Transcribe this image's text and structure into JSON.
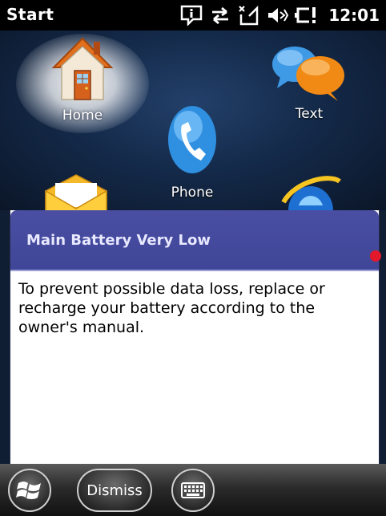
{
  "status_bar": {
    "title": "Start",
    "time": "12:01",
    "icons": [
      "notification-icon",
      "sync-icon",
      "no-signal-icon",
      "volume-muted-icon",
      "battery-low-icon"
    ]
  },
  "home": {
    "tiles": [
      {
        "label": "Home",
        "icon": "house-icon"
      },
      {
        "label": "Phone",
        "icon": "phone-icon"
      },
      {
        "label": "Text",
        "icon": "speech-bubbles-icon"
      },
      {
        "label": "",
        "icon": "mail-icon"
      },
      {
        "label": "",
        "icon": "internet-explorer-icon"
      }
    ]
  },
  "dialog": {
    "title": "Main Battery Very Low",
    "message": "To prevent possible data loss, replace or recharge your battery according to the owner's manual."
  },
  "bottom_bar": {
    "dismiss_label": "Dismiss",
    "start_icon": "windows-logo-icon",
    "keyboard_icon": "keyboard-icon"
  },
  "colors": {
    "dialog_header": "#4a4fa3",
    "status_bar": "#000000",
    "alert_dot": "#e3192b"
  }
}
